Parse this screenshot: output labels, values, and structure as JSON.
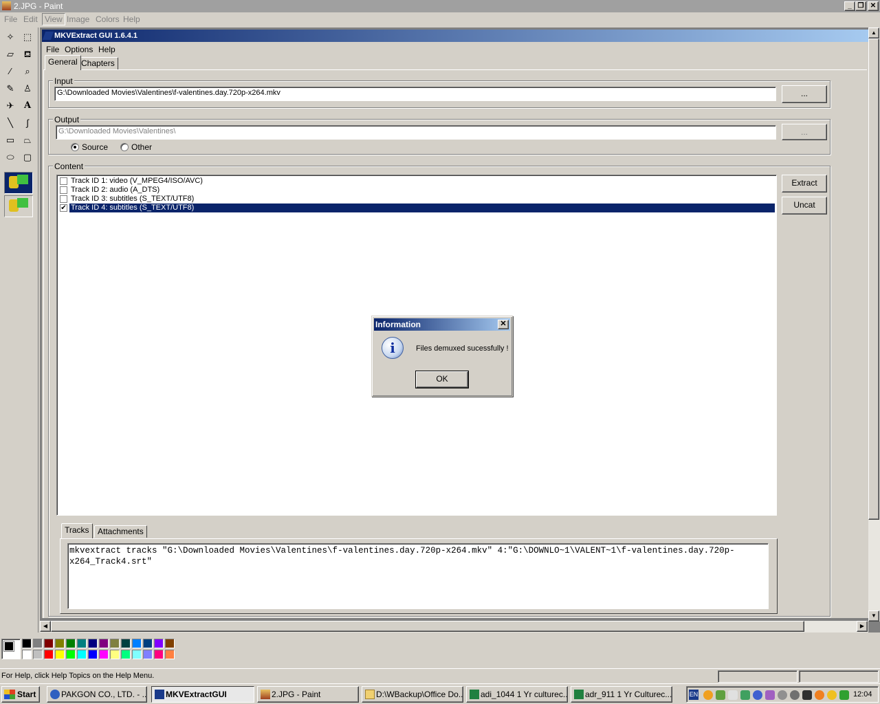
{
  "paint": {
    "title": "2.JPG - Paint",
    "menu": [
      "File",
      "Edit",
      "View",
      "Image",
      "Colors",
      "Help"
    ],
    "status": "For Help, click Help Topics on the Help Menu."
  },
  "mkv": {
    "title": "MKVExtract GUI 1.6.4.1",
    "menu": [
      "File",
      "Options",
      "Help"
    ],
    "tabs": [
      "General",
      "Chapters"
    ],
    "input": {
      "legend": "Input",
      "value": "G:\\Downloaded Movies\\Valentines\\f-valentines.day.720p-x264.mkv",
      "browse": "..."
    },
    "output": {
      "legend": "Output",
      "value": "G:\\Downloaded Movies\\Valentines\\",
      "browse": "...",
      "source_label": "Source",
      "other_label": "Other",
      "selected": "Source"
    },
    "content": {
      "legend": "Content",
      "tracks": [
        {
          "label": "Track ID 1: video (V_MPEG4/ISO/AVC)",
          "checked": false
        },
        {
          "label": "Track ID 2: audio (A_DTS)",
          "checked": false
        },
        {
          "label": "Track ID 3: subtitles (S_TEXT/UTF8)",
          "checked": false
        },
        {
          "label": "Track ID 4: subtitles (S_TEXT/UTF8)",
          "checked": true
        }
      ],
      "extract": "Extract",
      "uncat": "Uncat"
    },
    "bottom_tabs": [
      "Tracks",
      "Attachments"
    ],
    "command": "mkvextract tracks \"G:\\Downloaded Movies\\Valentines\\f-valentines.day.720p-x264.mkv\" 4:\"G:\\DOWNLO~1\\VALENT~1\\f-valentines.day.720p-x264_Track4.srt\""
  },
  "dialog": {
    "title": "Information",
    "message": "Files demuxed sucessfully !",
    "ok": "OK",
    "close": "✕"
  },
  "taskbar": {
    "start": "Start",
    "tasks": [
      "PAKGON CO., LTD. - ...",
      "MKVExtractGUI",
      "2.JPG - Paint",
      "D:\\WBackup\\Office Do...",
      "adi_1044 1 Yr culturec...",
      "adr_911 1 Yr Culturec..."
    ],
    "active_task": "MKVExtractGUI",
    "lang": "EN",
    "clock": "12:04"
  },
  "colors": {
    "titlebar_active": "#0a246a",
    "titlebar_gradient_end": "#a6caf0",
    "selection": "#0a246a",
    "face": "#d4d0c8"
  },
  "palette": [
    "#000000",
    "#808080",
    "#800000",
    "#808000",
    "#008000",
    "#008080",
    "#000080",
    "#800080",
    "#808040",
    "#004040",
    "#0080ff",
    "#004080",
    "#8000ff",
    "#804000",
    "#ffffff",
    "#c0c0c0",
    "#ff0000",
    "#ffff00",
    "#00ff00",
    "#00ffff",
    "#0000ff",
    "#ff00ff",
    "#ffff80",
    "#00ff80",
    "#80ffff",
    "#8080ff",
    "#ff0080",
    "#ff8040"
  ]
}
